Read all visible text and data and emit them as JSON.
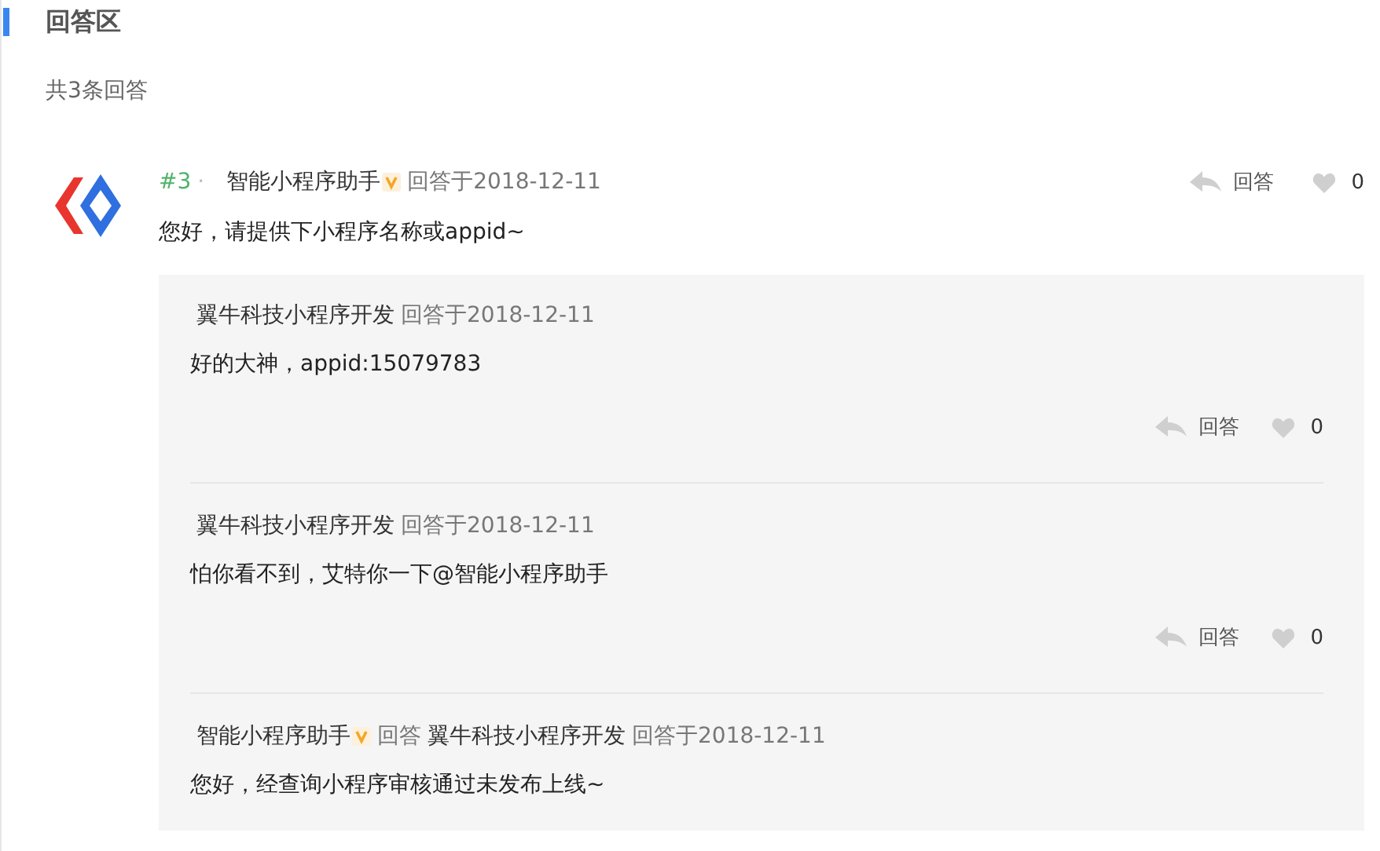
{
  "section": {
    "title": "回答区",
    "count": "共3条回答"
  },
  "answer": {
    "index": "#3",
    "separator": "·",
    "author": "智能小程序助手",
    "verified": true,
    "time": "回答于2018-12-11",
    "content": "您好，请提供下小程序名称或appid~",
    "reply_label": "回答",
    "likes": "0"
  },
  "replies": [
    {
      "author": "翼牛科技小程序开发",
      "verified": false,
      "time": "回答于2018-12-11",
      "content": "好的大神，appid:15079783",
      "reply_label": "回答",
      "likes": "0"
    },
    {
      "author": "翼牛科技小程序开发",
      "verified": false,
      "time": "回答于2018-12-11",
      "content": "怕你看不到，艾特你一下@智能小程序助手",
      "reply_label": "回答",
      "likes": "0"
    },
    {
      "author": "智能小程序助手",
      "verified": true,
      "reply_word": "回答",
      "target": "翼牛科技小程序开发",
      "time": "回答于2018-12-11",
      "content": "您好，经查询小程序审核通过未发布上线~"
    }
  ]
}
